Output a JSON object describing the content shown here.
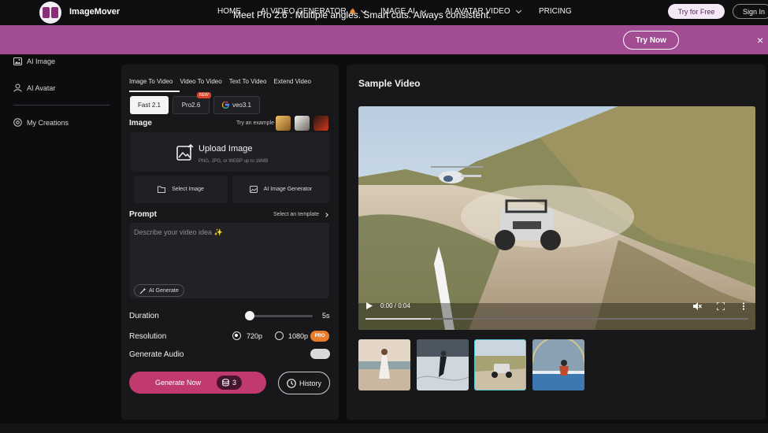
{
  "header": {
    "brand": "ImageMover",
    "nav": [
      {
        "label": "HOME"
      },
      {
        "label": "AI VIDEO GENERATOR",
        "badge_icon": "fire-icon"
      },
      {
        "label": "IMAGE AI"
      },
      {
        "label": "AI AVATAR VIDEO"
      },
      {
        "label": "PRICING"
      }
    ],
    "try_free": "Try for Free",
    "sign_in": "Sign In"
  },
  "promo": {
    "text": "Meet Pro 2.6 : Multiple angles. Smart cuts. Always consistent.",
    "button": "Try Now",
    "close": "×"
  },
  "sidebar": {
    "items": [
      {
        "label": "AI Image",
        "icon": "image-icon"
      },
      {
        "label": "AI Avatar",
        "icon": "user-icon"
      },
      {
        "label": "My Creations",
        "icon": "creations-icon"
      }
    ]
  },
  "generator": {
    "tabs": [
      "Image To Video",
      "Video To Video",
      "Text To Video",
      "Extend Video"
    ],
    "models": [
      {
        "label": "Fast 2.1",
        "active": true
      },
      {
        "label": "Pro2.6",
        "badge": "NEW"
      },
      {
        "label": "veo3.1",
        "icon": "google-icon"
      }
    ],
    "image_label": "Image",
    "try_example": "Try an example",
    "upload_title": "Upload Image",
    "upload_sub": "PNG, JPG, or WEBP up to 16MB",
    "select_image": "Select Image",
    "ai_image_generator": "AI Image Generator",
    "prompt_label": "Prompt",
    "select_template": "Select an template",
    "prompt_placeholder": "Describe your video idea ✨",
    "ai_generate": "AI Generate",
    "duration_label": "Duration",
    "duration_value": "5s",
    "duration_fraction": 0.0,
    "resolution_label": "Resolution",
    "resolutions": [
      {
        "label": "720p",
        "selected": true
      },
      {
        "label": "1080p",
        "badge": "PRO"
      }
    ],
    "audio_label": "Generate Audio",
    "audio_on": false,
    "generate_now": "Generate Now",
    "credits": "3",
    "history": "History"
  },
  "preview": {
    "title": "Sample Video",
    "time": "0:00 / 0:04",
    "progress_fraction": 0.17,
    "thumbnails": [
      {
        "name": "beach-thumb",
        "active": false
      },
      {
        "name": "skating-thumb",
        "active": false
      },
      {
        "name": "buggy-thumb",
        "active": true
      },
      {
        "name": "bike-thumb",
        "active": false
      }
    ]
  },
  "colors": {
    "promo": "#a24d93",
    "generate": "#c0396f",
    "pro_badge": "#e87c2a",
    "active_thumb": "#59c8d6"
  }
}
